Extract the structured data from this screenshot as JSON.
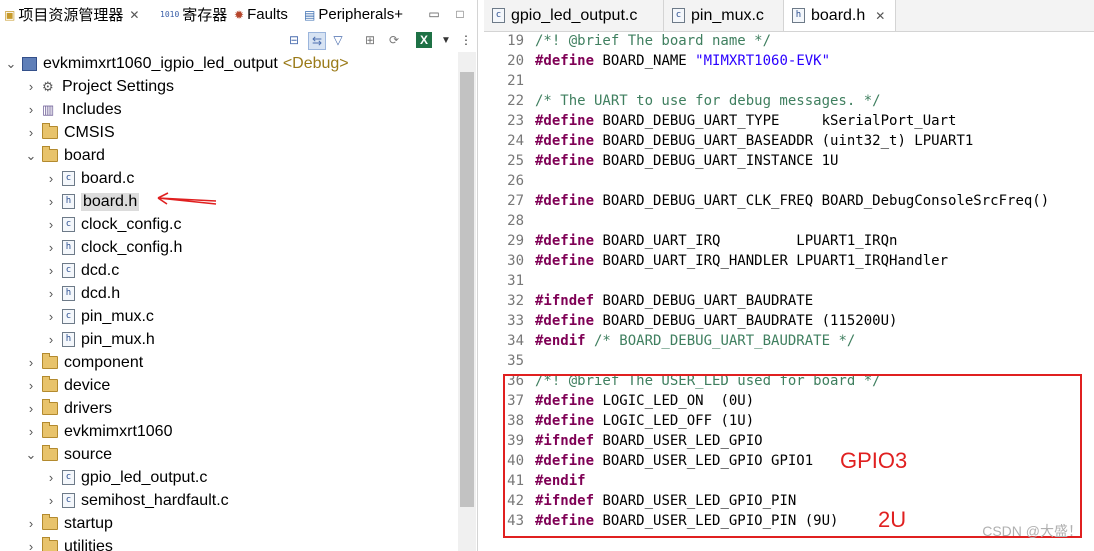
{
  "left_tabs": [
    {
      "label": "项目资源管理器",
      "icon": "project-explorer-icon"
    },
    {
      "label": "寄存器",
      "icon": "registers-icon"
    },
    {
      "label": "Faults",
      "icon": "faults-icon"
    },
    {
      "label": "Peripherals+",
      "icon": "peripherals-icon"
    }
  ],
  "tree": [
    {
      "label": "evkmimxrt1060_igpio_led_output",
      "suffix": "<Debug>",
      "type": "project",
      "expanded": true
    },
    {
      "label": "Project Settings",
      "type": "settings"
    },
    {
      "label": "Includes",
      "type": "includes"
    },
    {
      "label": "CMSIS",
      "type": "folder"
    },
    {
      "label": "board",
      "type": "folder",
      "expanded": true
    },
    {
      "label": "board.c",
      "type": "c"
    },
    {
      "label": "board.h",
      "type": "h",
      "selected": true
    },
    {
      "label": "clock_config.c",
      "type": "c"
    },
    {
      "label": "clock_config.h",
      "type": "h"
    },
    {
      "label": "dcd.c",
      "type": "c"
    },
    {
      "label": "dcd.h",
      "type": "h"
    },
    {
      "label": "pin_mux.c",
      "type": "c"
    },
    {
      "label": "pin_mux.h",
      "type": "h"
    },
    {
      "label": "component",
      "type": "folder"
    },
    {
      "label": "device",
      "type": "folder"
    },
    {
      "label": "drivers",
      "type": "folder"
    },
    {
      "label": "evkmimxrt1060",
      "type": "folder"
    },
    {
      "label": "source",
      "type": "folder",
      "expanded": true
    },
    {
      "label": "gpio_led_output.c",
      "type": "c"
    },
    {
      "label": "semihost_hardfault.c",
      "type": "c"
    },
    {
      "label": "startup",
      "type": "folder"
    },
    {
      "label": "utilities",
      "type": "folder"
    }
  ],
  "editor_tabs": [
    {
      "label": "gpio_led_output.c",
      "type": "c"
    },
    {
      "label": "pin_mux.c",
      "type": "c"
    },
    {
      "label": "board.h",
      "type": "h",
      "active": true
    }
  ],
  "code_lines": [
    {
      "n": "19",
      "parts": [
        [
          "cm",
          "/*! @brief The board name */"
        ]
      ]
    },
    {
      "n": "20",
      "parts": [
        [
          "kw",
          "#define"
        ],
        [
          "",
          " BOARD_NAME "
        ],
        [
          "str",
          "\"MIMXRT1060-EVK\""
        ]
      ]
    },
    {
      "n": "21",
      "parts": []
    },
    {
      "n": "22",
      "parts": [
        [
          "cm",
          "/* The UART to use for debug messages. */"
        ]
      ]
    },
    {
      "n": "23",
      "parts": [
        [
          "kw",
          "#define"
        ],
        [
          "",
          " BOARD_DEBUG_UART_TYPE     kSerialPort_Uart"
        ]
      ]
    },
    {
      "n": "24",
      "parts": [
        [
          "kw",
          "#define"
        ],
        [
          "",
          " BOARD_DEBUG_UART_BASEADDR (uint32_t) LPUART1"
        ]
      ]
    },
    {
      "n": "25",
      "parts": [
        [
          "kw",
          "#define"
        ],
        [
          "",
          " BOARD_DEBUG_UART_INSTANCE 1U"
        ]
      ]
    },
    {
      "n": "26",
      "parts": []
    },
    {
      "n": "27",
      "parts": [
        [
          "kw",
          "#define"
        ],
        [
          "",
          " BOARD_DEBUG_UART_CLK_FREQ BOARD_DebugConsoleSrcFreq()"
        ]
      ]
    },
    {
      "n": "28",
      "parts": []
    },
    {
      "n": "29",
      "parts": [
        [
          "kw",
          "#define"
        ],
        [
          "",
          " BOARD_UART_IRQ         LPUART1_IRQn"
        ]
      ]
    },
    {
      "n": "30",
      "parts": [
        [
          "kw",
          "#define"
        ],
        [
          "",
          " BOARD_UART_IRQ_HANDLER LPUART1_IRQHandler"
        ]
      ]
    },
    {
      "n": "31",
      "parts": []
    },
    {
      "n": "32",
      "parts": [
        [
          "kw",
          "#ifndef"
        ],
        [
          "",
          " BOARD_DEBUG_UART_BAUDRATE"
        ]
      ]
    },
    {
      "n": "33",
      "parts": [
        [
          "kw",
          "#define"
        ],
        [
          "",
          " BOARD_DEBUG_UART_BAUDRATE (115200U)"
        ]
      ]
    },
    {
      "n": "34",
      "parts": [
        [
          "kw",
          "#endif"
        ],
        [
          "cm",
          " /* BOARD_DEBUG_UART_BAUDRATE */"
        ]
      ]
    },
    {
      "n": "35",
      "parts": []
    },
    {
      "n": "36",
      "parts": [
        [
          "cm",
          "/*! @brief The USER_LED used for board */"
        ]
      ]
    },
    {
      "n": "37",
      "parts": [
        [
          "kw",
          "#define"
        ],
        [
          "",
          " LOGIC_LED_ON  (0U)"
        ]
      ]
    },
    {
      "n": "38",
      "parts": [
        [
          "kw",
          "#define"
        ],
        [
          "",
          " LOGIC_LED_OFF (1U)"
        ]
      ]
    },
    {
      "n": "39",
      "parts": [
        [
          "kw",
          "#ifndef"
        ],
        [
          "",
          " BOARD_USER_LED_GPIO"
        ]
      ]
    },
    {
      "n": "40",
      "parts": [
        [
          "kw",
          "#define"
        ],
        [
          "",
          " BOARD_USER_LED_GPIO GPIO1"
        ]
      ]
    },
    {
      "n": "41",
      "parts": [
        [
          "kw",
          "#endif"
        ]
      ]
    },
    {
      "n": "42",
      "parts": [
        [
          "kw",
          "#ifndef"
        ],
        [
          "",
          " BOARD_USER_LED_GPIO_PIN"
        ]
      ]
    },
    {
      "n": "43",
      "parts": [
        [
          "kw",
          "#define"
        ],
        [
          "",
          " BOARD_USER_LED_GPIO_PIN (9U)"
        ]
      ]
    }
  ],
  "annotations": {
    "gpio": "GPIO3",
    "pin": "2U"
  },
  "watermark": "CSDN @大盛！",
  "colors": {
    "annotation": "#e02020",
    "keyword": "#7f0055",
    "comment": "#3f7f5f",
    "string": "#2a00ff"
  }
}
